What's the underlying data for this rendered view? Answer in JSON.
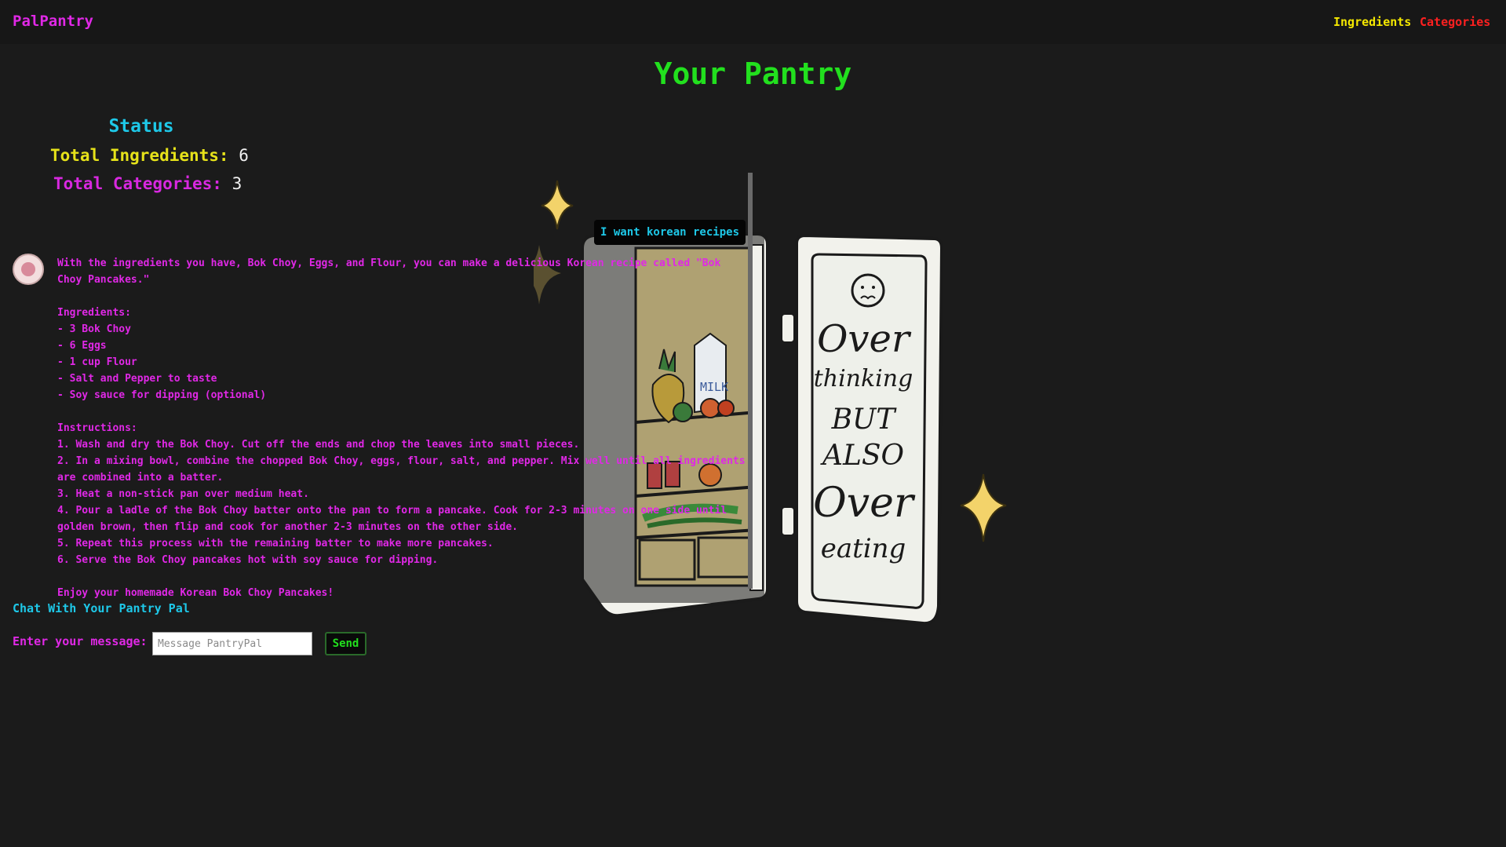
{
  "nav": {
    "brand": "PalPantry",
    "links": [
      {
        "label": "Ingredients",
        "color": "#f5e800"
      },
      {
        "label": "Categories",
        "color": "#ff2020"
      }
    ]
  },
  "page_title": "Your Pantry",
  "status": {
    "heading": "Status",
    "total_ingredients_label": "Total Ingredients:",
    "total_ingredients_value": "6",
    "total_categories_label": "Total Categories:",
    "total_categories_value": "3"
  },
  "illustration": {
    "door_text": [
      "Over",
      "thinking",
      "BUT",
      "ALSO",
      "Over",
      "eating"
    ],
    "milk_label": "MILK"
  },
  "chat": {
    "user_message": "I want korean recipes",
    "bot_message": "With the ingredients you have, Bok Choy, Eggs, and Flour, you can make a delicious Korean recipe called \"Bok Choy Pancakes.\"\n\nIngredients:\n- 3 Bok Choy\n- 6 Eggs\n- 1 cup Flour\n- Salt and Pepper to taste\n- Soy sauce for dipping (optional)\n\nInstructions:\n1. Wash and dry the Bok Choy. Cut off the ends and chop the leaves into small pieces.\n2. In a mixing bowl, combine the chopped Bok Choy, eggs, flour, salt, and pepper. Mix well until all ingredients are combined into a batter.\n3. Heat a non-stick pan over medium heat.\n4. Pour a ladle of the Bok Choy batter onto the pan to form a pancake. Cook for 2-3 minutes on one side until golden brown, then flip and cook for another 2-3 minutes on the other side.\n5. Repeat this process with the remaining batter to make more pancakes.\n6. Serve the Bok Choy pancakes hot with soy sauce for dipping.\n\nEnjoy your homemade Korean Bok Choy Pancakes!",
    "heading": "Chat With Your Pantry Pal",
    "input_label": "Enter your message:",
    "input_placeholder": "Message PantryPal",
    "input_value": "",
    "send_label": "Send"
  },
  "colors": {
    "background": "#1b1b1b",
    "magenta": "#e028e6",
    "green": "#22e01e",
    "cyan": "#1ec8e8",
    "yellow": "#e6e21a",
    "sparkle": "#f3d36a"
  }
}
